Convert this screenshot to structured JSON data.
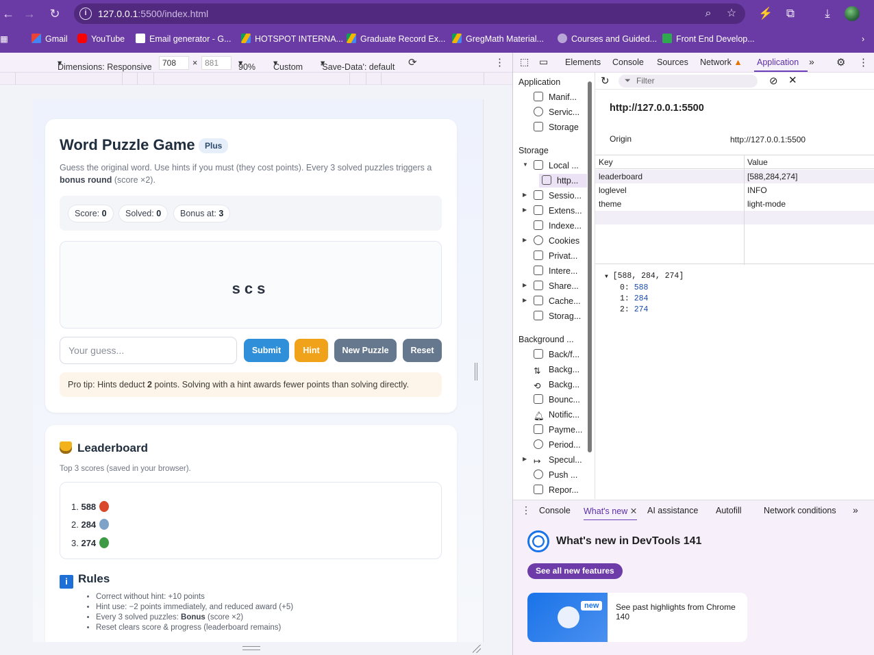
{
  "browser": {
    "url_host": "127.0.0.1",
    "url_rest": ":5500/index.html",
    "bookmarks": [
      "Gmail",
      "YouTube",
      "Email generator - G...",
      "HOTSPOT INTERNA...",
      "Graduate Record Ex...",
      "GregMath Material...",
      "Courses and Guided...",
      "Front End Develop..."
    ]
  },
  "device_toolbar": {
    "dimensions_label": "Dimensions: Responsive",
    "width": "708",
    "times": "×",
    "height": "881",
    "zoom": "90%",
    "throttle": "Custom",
    "save_data": "'Save-Data': default"
  },
  "game": {
    "title": "Word Puzzle Game",
    "badge": "Plus",
    "desc_1": "Guess the original word. Use hints if you must (they cost points). Every 3 solved puzzles triggers a",
    "desc_bold": "bonus round",
    "desc_2": " (score ×2).",
    "score_label": "Score:",
    "score": "0",
    "solved_label": "Solved:",
    "solved": "0",
    "bonus_label": "Bonus at:",
    "bonus": "3",
    "scramble": "scs",
    "guess_placeholder": "Your guess...",
    "submit": "Submit",
    "hint": "Hint",
    "new_puzzle": "New Puzzle",
    "reset": "Reset",
    "tip_1": "Pro tip: Hints deduct ",
    "tip_bold": "2",
    "tip_2": " points. Solving with a hint awards fewer points than solving directly."
  },
  "leaderboard": {
    "title": "Leaderboard",
    "subtitle": "Top 3 scores (saved in your browser).",
    "entries": [
      {
        "rank": "1.",
        "score": "588",
        "medal_color": "#d9482b"
      },
      {
        "rank": "2.",
        "score": "284",
        "medal_color": "#7fa2c8"
      },
      {
        "rank": "3.",
        "score": "274",
        "medal_color": "#3f9a45"
      }
    ]
  },
  "rules": {
    "title": "Rules",
    "items": [
      "Correct without hint: +10 points",
      "Hint use: −2 points immediately, and reduced award (+5)",
      "Every 3 solved puzzles: ",
      "Reset clears score & progress (leaderboard remains)"
    ],
    "bonus_bold": "Bonus",
    "bonus_tail": " (score ×2)"
  },
  "devtools": {
    "tabs": [
      "Elements",
      "Console",
      "Sources",
      "Network",
      "Application"
    ],
    "active_tab": "Application",
    "sidebar": {
      "app_head": "Application",
      "app_items": [
        "Manif...",
        "Servic...",
        "Storage"
      ],
      "storage_head": "Storage",
      "storage_items": [
        "Local ...",
        "http...",
        "Sessio...",
        "Extens...",
        "Indexe...",
        "Cookies",
        "Privat...",
        "Intere...",
        "Share...",
        "Cache...",
        "Storag..."
      ],
      "bg_head": "Background ...",
      "bg_items": [
        "Back/f...",
        "Backg...",
        "Backg...",
        "Bounc...",
        "Notific...",
        "Payme...",
        "Period...",
        "Specul...",
        "Push ...",
        "Repor..."
      ]
    },
    "filter_placeholder": "Filter",
    "origin_title": "http://127.0.0.1:5500",
    "origin_label": "Origin",
    "origin_value": "http://127.0.0.1:5500",
    "kv_header": {
      "key": "Key",
      "value": "Value"
    },
    "kv_rows": [
      {
        "key": "leaderboard",
        "value": "[588,284,274]"
      },
      {
        "key": "loglevel",
        "value": "INFO"
      },
      {
        "key": "theme",
        "value": "light-mode"
      }
    ],
    "preview_head": "[588, 284, 274]",
    "preview_items": [
      {
        "i": "0:",
        "v": "588"
      },
      {
        "i": "1:",
        "v": "284"
      },
      {
        "i": "2:",
        "v": "274"
      }
    ],
    "drawer_tabs": [
      "Console",
      "What's new",
      "AI assistance",
      "Autofill",
      "Network conditions"
    ],
    "whats_new_title": "What's new in DevTools 141",
    "see_all": "See all new features",
    "highlight_badge": "new",
    "highlight_text": "See past highlights from Chrome 140"
  }
}
